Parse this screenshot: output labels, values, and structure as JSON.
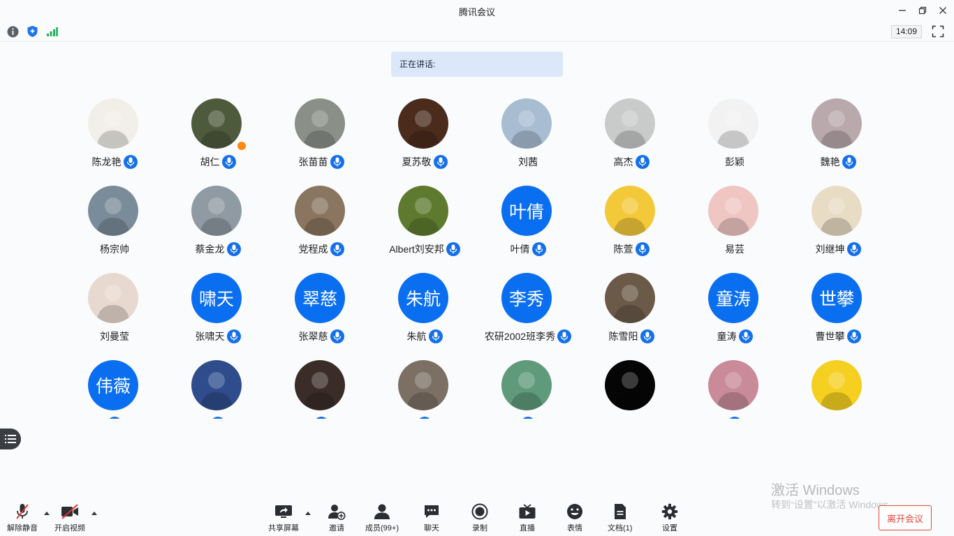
{
  "window": {
    "title": "腾讯会议"
  },
  "status": {
    "clock": "14:09"
  },
  "speaking": {
    "label": "正在讲话:"
  },
  "participants": [
    {
      "name": "陈龙艳",
      "mic": true,
      "avatar": "photo",
      "color": "#f2efe8"
    },
    {
      "name": "胡仁",
      "mic": true,
      "avatar": "photo",
      "color": "#4d5a3c",
      "host": true
    },
    {
      "name": "张苗苗",
      "mic": true,
      "avatar": "photo",
      "color": "#8a8f88"
    },
    {
      "name": "夏苏敬",
      "mic": true,
      "avatar": "photo",
      "color": "#4a2b1c"
    },
    {
      "name": "刘茜",
      "mic": false,
      "avatar": "photo",
      "color": "#a8bdd2"
    },
    {
      "name": "高杰",
      "mic": true,
      "avatar": "photo",
      "color": "#c9cbcb"
    },
    {
      "name": "彭颖",
      "mic": false,
      "avatar": "photo",
      "color": "#f2f2f2"
    },
    {
      "name": "魏艳",
      "mic": true,
      "avatar": "photo",
      "color": "#b9a9ad"
    },
    {
      "name": "杨宗帅",
      "mic": false,
      "avatar": "photo",
      "color": "#7a8c99"
    },
    {
      "name": "蔡金龙",
      "mic": true,
      "avatar": "photo",
      "color": "#8f9aa3"
    },
    {
      "name": "党程成",
      "mic": true,
      "avatar": "photo",
      "color": "#8a7560"
    },
    {
      "name": "Albert刘安邦",
      "mic": true,
      "avatar": "photo",
      "color": "#5d7a2e"
    },
    {
      "name": "叶倩",
      "mic": true,
      "avatar": "text",
      "text": "叶倩"
    },
    {
      "name": "陈萱",
      "mic": true,
      "avatar": "photo",
      "color": "#f3c93a"
    },
    {
      "name": "易芸",
      "mic": false,
      "avatar": "photo",
      "color": "#f0c6c3"
    },
    {
      "name": "刘继坤",
      "mic": true,
      "avatar": "photo",
      "color": "#e8dcc4"
    },
    {
      "name": "刘曼莹",
      "mic": false,
      "avatar": "photo",
      "color": "#e8d9d0"
    },
    {
      "name": "张啸天",
      "mic": true,
      "avatar": "text",
      "text": "啸天"
    },
    {
      "name": "张翠慈",
      "mic": true,
      "avatar": "text",
      "text": "翠慈"
    },
    {
      "name": "朱航",
      "mic": true,
      "avatar": "text",
      "text": "朱航"
    },
    {
      "name": "农研2002班李秀",
      "mic": true,
      "avatar": "text",
      "text": "李秀"
    },
    {
      "name": "陈雪阳",
      "mic": true,
      "avatar": "photo",
      "color": "#6b5a48"
    },
    {
      "name": "童涛",
      "mic": true,
      "avatar": "text",
      "text": "童涛"
    },
    {
      "name": "曹世攀",
      "mic": true,
      "avatar": "text",
      "text": "世攀"
    },
    {
      "name": "",
      "mic": true,
      "avatar": "text",
      "text": "伟薇"
    },
    {
      "name": "",
      "mic": true,
      "avatar": "photo",
      "color": "#2f4d8c"
    },
    {
      "name": "",
      "mic": true,
      "avatar": "photo",
      "color": "#3a2d28"
    },
    {
      "name": "",
      "mic": true,
      "avatar": "photo",
      "color": "#7c7064"
    },
    {
      "name": "",
      "mic": true,
      "avatar": "photo",
      "color": "#5f9a7a"
    },
    {
      "name": "",
      "mic": false,
      "avatar": "photo",
      "color": "#050505"
    },
    {
      "name": "",
      "mic": true,
      "avatar": "photo",
      "color": "#c98a9a"
    },
    {
      "name": "",
      "mic": false,
      "avatar": "photo",
      "color": "#f5d020"
    }
  ],
  "toolbar": {
    "unmute": "解除静音",
    "video": "开启视频",
    "share": "共享屏幕",
    "invite": "邀请",
    "members": "成员(99+)",
    "chat": "聊天",
    "record": "录制",
    "live": "直播",
    "emoji": "表情",
    "docs": "文档(1)",
    "settings": "设置",
    "leave": "离开会议"
  },
  "watermark": {
    "line1": "激活 Windows",
    "line2": "转到“设置”以激活 Windows。"
  },
  "colors": {
    "accent": "#0a6ef0",
    "danger": "#e0453a",
    "banner": "#dce8fa"
  }
}
